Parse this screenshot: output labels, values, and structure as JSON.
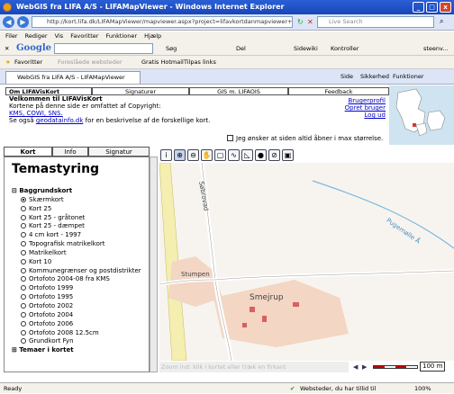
{
  "window": {
    "title": "WebGIS fra LIFA A/S - LIFAMapViewer - Windows Internet Explorer"
  },
  "addressbar": {
    "url": "http://kort.lifa.dk/LIFAMapViewer/mapviewer.aspx?project=lifavkortdanmapviewer+pm",
    "search_placeholder": "Live Search"
  },
  "menu": [
    "Filer",
    "Rediger",
    "Vis",
    "Favoritter",
    "Funktioner",
    "Hjælp"
  ],
  "googlebar": {
    "logo": "Google",
    "search_label": "Søg",
    "items": [
      "Del",
      "Sidewiki",
      "Kontroller",
      "steenv..."
    ]
  },
  "favbar": {
    "favorites": "Favoritter",
    "items": [
      "Foreslåede websteder",
      "Gratis Hotmail",
      "Tilpas links"
    ]
  },
  "tab": {
    "label": "WebGIS fra LIFA A/S - LIFAMapViewer",
    "tools": [
      "Side",
      "Sikkerhed",
      "Funktioner"
    ]
  },
  "page_tabs": [
    "Om LIFAVisKort",
    "Signaturer",
    "GIS m. LIFAOIS",
    "Feedback"
  ],
  "info": {
    "title": "Velkommen til LIFAVisKort",
    "line1": "Kortene på denne side er omfattet af Copyright:",
    "copyright_links": "KMS, COWI, SNS.",
    "see_prefix": "Se også",
    "see_link": "geodatainfo.dk",
    "see_suffix": "for en beskrivelse af de forskellige kort.",
    "user_links": [
      "Brugerprofil",
      "Opret bruger",
      "Log ud"
    ]
  },
  "checkbox_label": "Jeg ønsker at siden altid åbner i max størrelse.",
  "left_tabs": [
    "Kort",
    "Info",
    "Signatur"
  ],
  "left": {
    "heading": "Temastyring",
    "group1": "Baggrundskort",
    "maps": [
      "Skærmkort",
      "Kort 25",
      "Kort 25 - gråtonet",
      "Kort 25 - dæmpet",
      "4 cm kort - 1997",
      "Topografisk matrikelkort",
      "Matrikelkort",
      "Kort 10",
      "Kommunegrænser og postdistrikter",
      "Ortofoto 2004-08 fra KMS",
      "Ortofoto 1999",
      "Ortofoto 1995",
      "Ortofoto 2002",
      "Ortofoto 2004",
      "Ortofoto 2006",
      "Ortofoto 2008 12.5cm",
      "Grundkort Fyn"
    ],
    "selected_index": 0,
    "group2": "Temaer i kortet"
  },
  "map": {
    "labels": [
      "Søbrovad",
      "Stumpen",
      "Smejrup",
      "Pugemølle Å"
    ],
    "hint": "Zoom ind: klik i kortet eller træk en firkant",
    "scale": "100 m"
  },
  "status": {
    "left": "Ready",
    "zone": "Websteder, du har tillid til",
    "zoom": "100%"
  }
}
